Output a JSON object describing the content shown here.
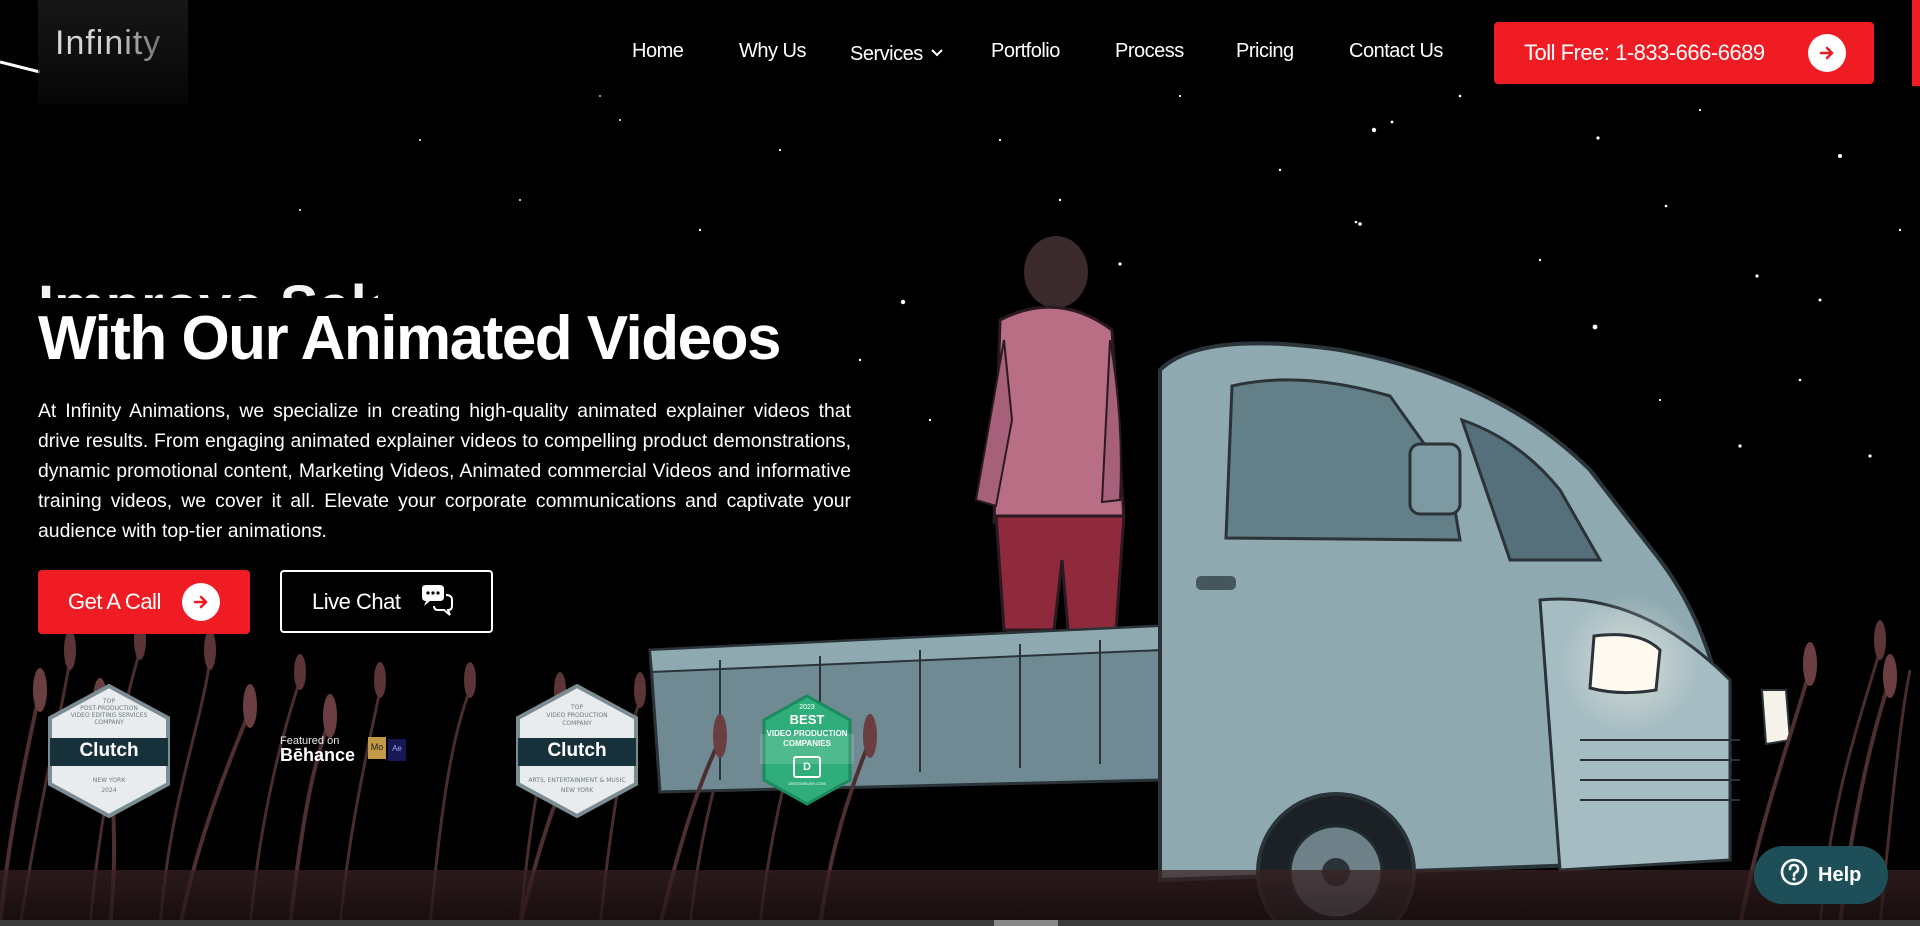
{
  "brand": {
    "logo_text": "Infinity"
  },
  "nav": {
    "items": [
      {
        "label": "Home"
      },
      {
        "label": "Why Us"
      },
      {
        "label": "Services"
      },
      {
        "label": "Portfolio"
      },
      {
        "label": "Process"
      },
      {
        "label": "Pricing"
      },
      {
        "label": "Contact Us"
      }
    ],
    "cta_label": "Toll Free: 1-833-666-6689"
  },
  "hero": {
    "partial_heading": "Improve Sales",
    "heading": "With Our Animated Videos",
    "description": "At Infinity Animations, we specialize in creating high-quality animated explainer videos that drive results. From engaging animated explainer videos to compelling product demonstrations, dynamic promotional content, Marketing Videos, Animated commercial Videos and informative training videos, we cover it all. Elevate your corporate communications and captivate your audience with top-tier animations.",
    "primary_button": "Get A Call",
    "secondary_button": "Live Chat"
  },
  "badges": {
    "clutch1": {
      "top": "TOP",
      "line1": "POST-PRODUCTION",
      "line2": "VIDEO EDITING SERVICES",
      "line3": "COMPANY",
      "name": "Clutch",
      "place": "NEW YORK",
      "year": "2024"
    },
    "behance": {
      "small": "Featured on",
      "big": "Bēhance",
      "mo": "Mo",
      "ae": "Ae"
    },
    "clutch2": {
      "top": "TOP",
      "line1": "VIDEO PRODUCTION",
      "line2": "COMPANY",
      "name": "Clutch",
      "line3": "ARTS, ENTERTAINMENT & MUSIC",
      "place": "NEW YORK"
    },
    "best": {
      "year": "2023",
      "title": "BEST",
      "line1": "VIDEO PRODUCTION",
      "line2": "COMPANIES",
      "source": "DESIGNRUSH.COM"
    }
  },
  "help": {
    "label": "Help"
  },
  "colors": {
    "accent": "#ef1c24",
    "help_bg": "#1e4f58",
    "badge_green": "#2fae7b",
    "truck": "#8fa9b1"
  }
}
